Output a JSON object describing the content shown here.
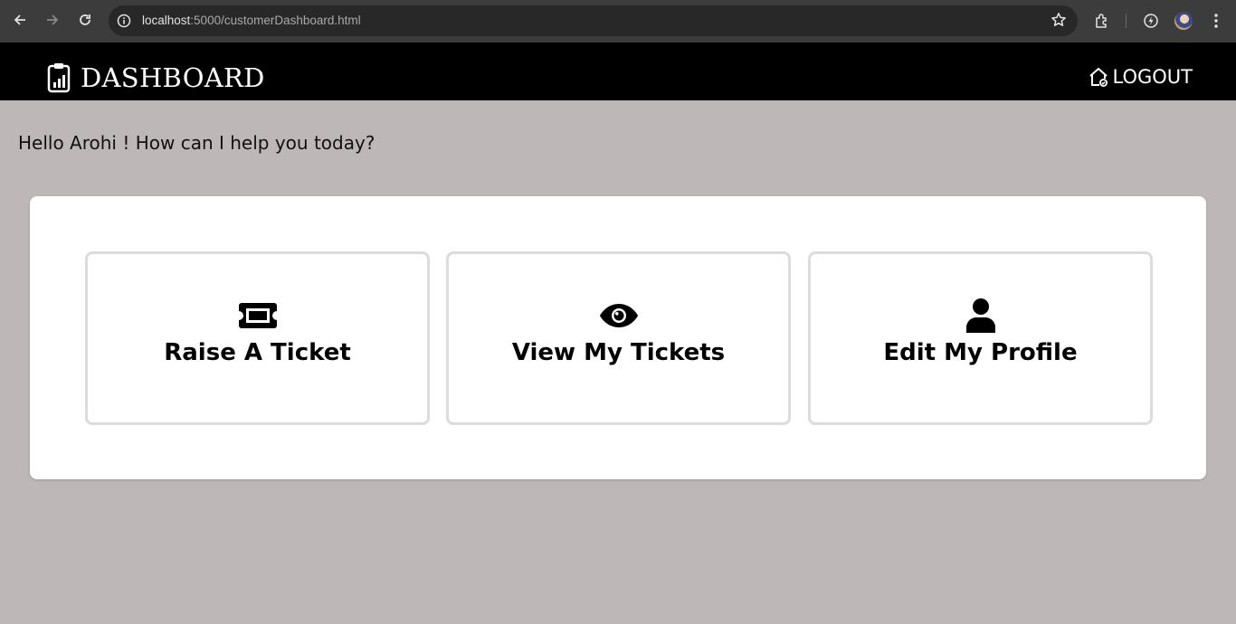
{
  "browser": {
    "url_host": "localhost",
    "url_path": ":5000/customerDashboard.html"
  },
  "header": {
    "title": "DASHBOARD",
    "logout_label": "LOGOUT"
  },
  "greeting": "Hello Arohi ! How can I help you today?",
  "cards": [
    {
      "label": "Raise A Ticket",
      "icon": "ticket-icon"
    },
    {
      "label": "View My Tickets",
      "icon": "eye-icon"
    },
    {
      "label": "Edit My Profile",
      "icon": "user-icon"
    }
  ],
  "colors": {
    "page_bg": "#bdb7b7",
    "header_bg": "#000000",
    "card_border": "#dcdcdc"
  }
}
